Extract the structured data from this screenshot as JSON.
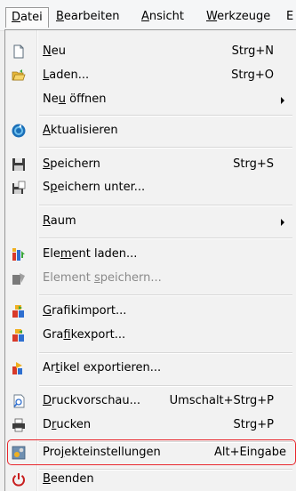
{
  "menubar": {
    "items": [
      {
        "label": "Datei",
        "accel": "D",
        "rest": "atei"
      },
      {
        "label": "Bearbeiten",
        "accel": "B",
        "rest": "earbeiten"
      },
      {
        "label": "Ansicht",
        "accel": "A",
        "rest": "nsicht"
      },
      {
        "label": "Werkzeuge",
        "accel": "W",
        "rest": "erkzeuge"
      },
      {
        "label": "E",
        "accel": "",
        "rest": "E"
      }
    ]
  },
  "menu": {
    "items": [
      {
        "pre": "",
        "accel": "N",
        "post": "eu",
        "shortcut": "Strg+N",
        "icon": "new-document-icon"
      },
      {
        "pre": "",
        "accel": "L",
        "post": "aden...",
        "shortcut": "Strg+O",
        "icon": "open-folder-icon"
      },
      {
        "pre": "Ne",
        "accel": "u",
        "post": " öffnen",
        "shortcut": "",
        "icon": ""
      },
      {
        "pre": "",
        "accel": "A",
        "post": "ktualisieren",
        "shortcut": "",
        "icon": "refresh-icon"
      },
      {
        "pre": "",
        "accel": "S",
        "post": "peichern",
        "shortcut": "Strg+S",
        "icon": "save-icon"
      },
      {
        "pre": "S",
        "accel": "p",
        "post": "eichern unter...",
        "shortcut": "",
        "icon": "save-as-icon"
      },
      {
        "pre": "",
        "accel": "R",
        "post": "aum",
        "shortcut": "",
        "icon": ""
      },
      {
        "pre": "Ele",
        "accel": "m",
        "post": "ent laden...",
        "shortcut": "",
        "icon": "element-load-icon"
      },
      {
        "pre": "Element ",
        "accel": "s",
        "post": "peichern...",
        "shortcut": "",
        "icon": "element-save-icon"
      },
      {
        "pre": "",
        "accel": "G",
        "post": "rafikimport...",
        "shortcut": "",
        "icon": "graphic-import-icon"
      },
      {
        "pre": "Gra",
        "accel": "f",
        "post": "ikexport...",
        "shortcut": "",
        "icon": "graphic-export-icon"
      },
      {
        "pre": "Ar",
        "accel": "t",
        "post": "ikel exportieren...",
        "shortcut": "",
        "icon": "article-export-icon"
      },
      {
        "pre": "",
        "accel": "D",
        "post": "ruckvorschau...",
        "shortcut": "Umschalt+Strg+P",
        "icon": "print-preview-icon"
      },
      {
        "pre": "D",
        "accel": "r",
        "post": "ucken",
        "shortcut": "Strg+P",
        "icon": "printer-icon"
      },
      {
        "pre": "Pro",
        "accel": "j",
        "post": "ekteinstellungen",
        "shortcut": "Alt+Eingabe",
        "icon": "project-settings-icon"
      },
      {
        "pre": "",
        "accel": "B",
        "post": "eenden",
        "shortcut": "",
        "icon": "power-icon"
      }
    ]
  },
  "colors": {
    "highlight_border": "#e8262c",
    "disabled_text": "#8a8a8a"
  }
}
